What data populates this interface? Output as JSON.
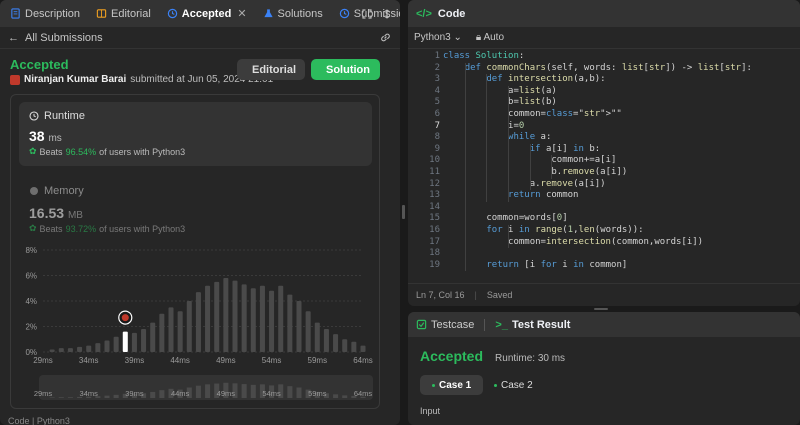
{
  "left_tabs": [
    {
      "label": "Description",
      "icon": "description-icon"
    },
    {
      "label": "Editorial",
      "icon": "book-icon"
    },
    {
      "label": "Accepted",
      "icon": "history-icon"
    },
    {
      "label": "Solutions",
      "icon": "flask-icon"
    },
    {
      "label": "Submissions",
      "icon": "history-icon"
    }
  ],
  "back_label": "All Submissions",
  "status": {
    "title": "Accepted",
    "user": "Niranjan Kumar Barai",
    "submitted": "submitted at Jun 05, 2024 21:01"
  },
  "buttons": {
    "editorial": "Editorial",
    "solution": "Solution"
  },
  "runtime": {
    "label": "Runtime",
    "value": "38",
    "unit": "ms",
    "beats_prefix": "Beats",
    "beats_pct": "96.54%",
    "beats_suffix": "of users with Python3"
  },
  "memory": {
    "label": "Memory",
    "value": "16.53",
    "unit": "MB",
    "beats_prefix": "Beats",
    "beats_pct": "93.72%",
    "beats_suffix": "of users with Python3"
  },
  "chart_data": {
    "type": "bar",
    "y_tick_labels": [
      "8%",
      "6%",
      "4%",
      "2%",
      "0%"
    ],
    "x_tick_labels": [
      "29ms",
      "34ms",
      "39ms",
      "44ms",
      "49ms",
      "54ms",
      "59ms",
      "64ms"
    ],
    "ylim": [
      0,
      8
    ],
    "xlim": [
      29,
      64
    ],
    "grid": true,
    "highlight_x": 38,
    "x": [
      30,
      31,
      32,
      33,
      34,
      35,
      36,
      37,
      38,
      39,
      40,
      41,
      42,
      43,
      44,
      45,
      46,
      47,
      48,
      49,
      50,
      51,
      52,
      53,
      54,
      55,
      56,
      57,
      58,
      59,
      60,
      61,
      62,
      63,
      64
    ],
    "values": [
      0.2,
      0.3,
      0.3,
      0.4,
      0.5,
      0.7,
      0.9,
      1.2,
      1.6,
      1.5,
      1.8,
      2.3,
      3.0,
      3.5,
      3.2,
      4.0,
      4.7,
      5.2,
      5.5,
      5.8,
      5.6,
      5.3,
      5.0,
      5.2,
      4.8,
      5.2,
      4.5,
      4.0,
      3.2,
      2.3,
      1.8,
      1.4,
      1.0,
      0.8,
      0.5
    ]
  },
  "code_panel": {
    "title": "Code",
    "language": "Python3",
    "auto_label": "Auto",
    "lines": [
      "class Solution:",
      "    def commonChars(self, words: list[str]) -> list[str]:",
      "        def intersection(a,b):",
      "            a=list(a)",
      "            b=list(b)",
      "            common=\"\"",
      "            i=0",
      "            while a:",
      "                if a[i] in b:",
      "                    common+=a[i]",
      "                    b.remove(a[i])",
      "                a.remove(a[i])",
      "            return common",
      "",
      "        common=words[0]",
      "        for i in range(1,len(words)):",
      "            common=intersection(common,words[i])",
      "",
      "        return [i for i in common]"
    ],
    "cursor": "Ln 7, Col 16",
    "saved": "Saved"
  },
  "result_panel": {
    "testcase_tab": "Testcase",
    "result_tab": "Test Result",
    "status": "Accepted",
    "runtime": "Runtime: 30 ms",
    "case1": "Case 1",
    "case2": "Case 2",
    "input_label": "Input"
  },
  "bottom_strip": "Code | Python3"
}
